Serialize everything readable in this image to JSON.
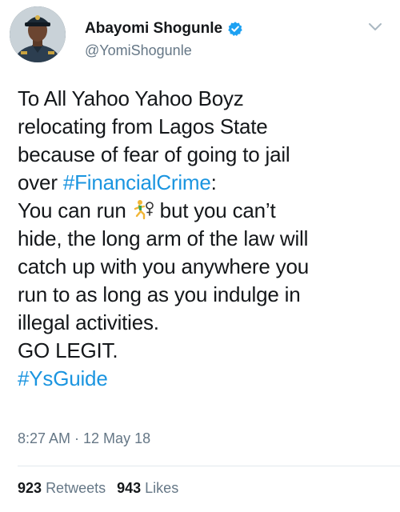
{
  "author": {
    "display_name": "Abayomi Shogunle",
    "handle": "@YomiShogunle",
    "verified": true
  },
  "tweet": {
    "lines": {
      "l1": "To All Yahoo Yahoo Boyz",
      "l2": "relocating from Lagos State",
      "l3": "because of fear of going to jail",
      "l4_pre": "over ",
      "l4_tag": "#FinancialCrime",
      "l4_post": ":",
      "l5_pre": "You can run ",
      "l5_post": " but you can’t",
      "l6": "hide, the long arm of the law will",
      "l7": "catch up with you anywhere you",
      "l8": "run to as long as you indulge in",
      "l9": "illegal activities.",
      "l10": "GO LEGIT.",
      "l11_tag": "#YsGuide"
    },
    "emoji": "woman-running-icon",
    "timestamp": "8:27 AM · 12 May 18"
  },
  "stats": {
    "retweets_count": "923",
    "retweets_label": "Retweets",
    "likes_count": "943",
    "likes_label": "Likes"
  },
  "colors": {
    "link": "#1b95e0",
    "muted": "#657786",
    "text": "#14171a",
    "divider": "#e1e8ed"
  }
}
